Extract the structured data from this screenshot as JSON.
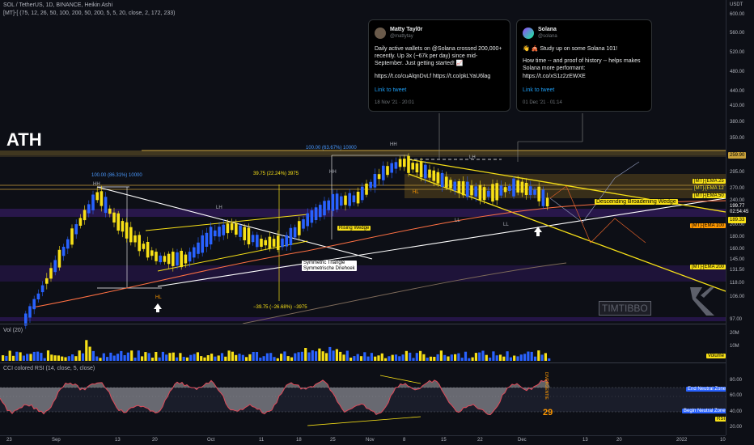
{
  "header": {
    "symbol_line": "SOL / TetherUS, 1D, BINANCE, Heikin Ashi",
    "indicator_line": "[MT]-[ (75, 12, 26, 50, 100, 200, 50, 200, 5, 5, 20, close, 2, 172, 233)"
  },
  "ath_label": "ATH",
  "price_axis": {
    "currency": "USDT",
    "ticks": [
      "600.00",
      "560.00",
      "520.00",
      "480.00",
      "440.00",
      "410.00",
      "380.00",
      "350.00",
      "320.00",
      "295.00",
      "270.00",
      "240.00",
      "220.00",
      "200.00",
      "180.00",
      "160.00",
      "145.00",
      "131.50",
      "118.00",
      "106.00",
      "97.00"
    ],
    "last_price": "199.77",
    "countdown": "02:54:45",
    "ath_price": "259.90",
    "low_price": "189.33"
  },
  "tweets": [
    {
      "name": "Matty Tayl0r",
      "handle": "@mattytay",
      "text": "Daily active wallets on @Solana crossed 200,000+ recently. Up 3x (~67k per day) since mid-September. Just getting started! 📈",
      "links": "https://t.co/cuAlqnDvLf https://t.co/pkLYaU6lag",
      "link_label": "Link to tweet",
      "date": "18 Nov '21 · 20:01"
    },
    {
      "name": "Solana",
      "handle": "@solana",
      "text": "👋 🎪 Study up on some Solana 101!",
      "text2": "How time -- and proof of history -- helps makes Solana more performant: https://t.co/xS1z2zEWXE",
      "link_label": "Link to tweet",
      "date": "01 Dec '21 · 01:14"
    }
  ],
  "indicator_tags": {
    "ema25": "[MT]-[EMA 25",
    "ema12": "[MT]-[EMA 12",
    "ema50": "[MT]-[EMA 50",
    "ema100": "[MT]-[EMA 100",
    "ema200": "[MT]-[EMA 200"
  },
  "annotations": {
    "range_top": "100.00 (63.67%) 10000",
    "range_left": "100.00 (86.31%) 10000",
    "range_mid_up": "39.75 (22.24%) 3975",
    "range_mid_down": "−39.75 (−26.68%) −3975",
    "hh1": "HH",
    "hh2": "HH",
    "hh3": "HH",
    "lh1": "LH",
    "lh2": "LH",
    "hl1": "HL",
    "hl2": "HL",
    "ll1": "LL",
    "ll2": "LL",
    "rising_wedge": "Rising Wedge",
    "sym_triangle": "Symmetric Triangle",
    "sym_triangle2": "Symmetrische Driehoek",
    "desc_wedge": "Descending Broadening Wedge",
    "watermark": "TIMTIBBO",
    "divergence": "DIVERGENTIE"
  },
  "volume_pane": {
    "title": "Vol (20)",
    "ticks": [
      "20M",
      "10M"
    ],
    "tag": "Volume"
  },
  "rsi_pane": {
    "title": "CCI colored RSI (14, close, 5, close)",
    "ticks": [
      "80.00",
      "60.00",
      "40.00",
      "20.00"
    ],
    "end_zone": "End Neutral Zone",
    "begin_zone": "Begin Neutral Zone",
    "rsi_tag": "RSI",
    "value_29": "29"
  },
  "date_axis": {
    "labels": [
      "23",
      "Sep",
      "13",
      "20",
      "Oct",
      "11",
      "18",
      "25",
      "Nov",
      "8",
      "15",
      "22",
      "Dec",
      "13",
      "20",
      "2022",
      "10"
    ]
  },
  "colors": {
    "up": "#2962ff",
    "down": "#f7e017",
    "bg": "#0d0f16",
    "ema_purple": "#7b2ff7",
    "resistance": "#c8a13a"
  }
}
